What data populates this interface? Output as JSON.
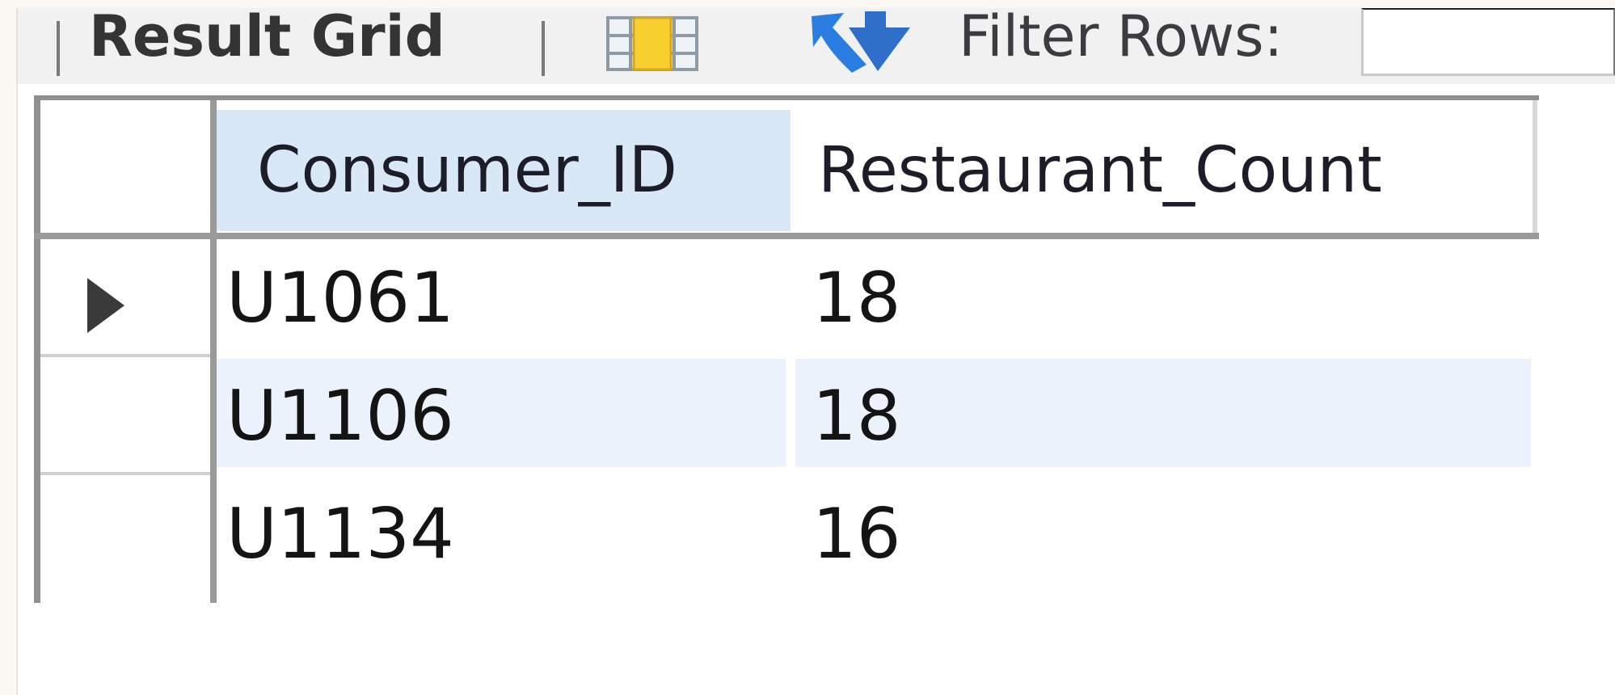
{
  "toolbar": {
    "result_grid_label": "Result Grid",
    "filter_label": "Filter Rows:",
    "filter_value": "",
    "icons": [
      "grid-view-icon",
      "refresh-icon"
    ]
  },
  "grid": {
    "columns": [
      "Consumer_ID",
      "Restaurant_Count"
    ],
    "rows": [
      [
        "U1061",
        "18"
      ],
      [
        "U1106",
        "18"
      ],
      [
        "U1134",
        "16"
      ]
    ],
    "current_row_index": 0,
    "colors": {
      "selected_header": "#d9e8f7",
      "alt_row": "#ebf2fb"
    }
  }
}
